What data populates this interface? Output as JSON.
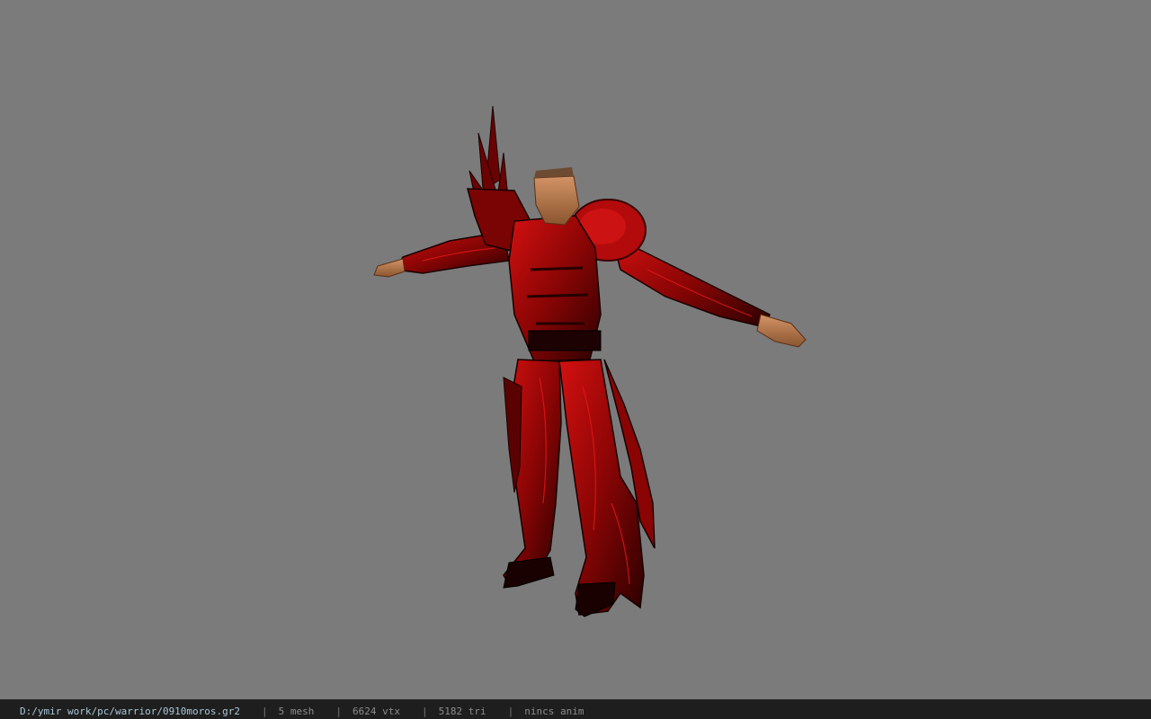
{
  "viewport": {
    "background": "#7b7b7b",
    "model_icon": "armored-warrior-model"
  },
  "status": {
    "file_path": "D:/ymir work/pc/warrior/0910moros.gr2",
    "separator": "|",
    "mesh": "5 mesh",
    "vertices": "6624 vtx",
    "triangles": "5182 tri",
    "animation": "nincs anim"
  },
  "colors": {
    "armor_red": "#b00a0a",
    "armor_dark": "#1a0202",
    "skin": "#c48552",
    "status_bg": "#1e1e1e",
    "path_text": "#a9c7d6"
  }
}
